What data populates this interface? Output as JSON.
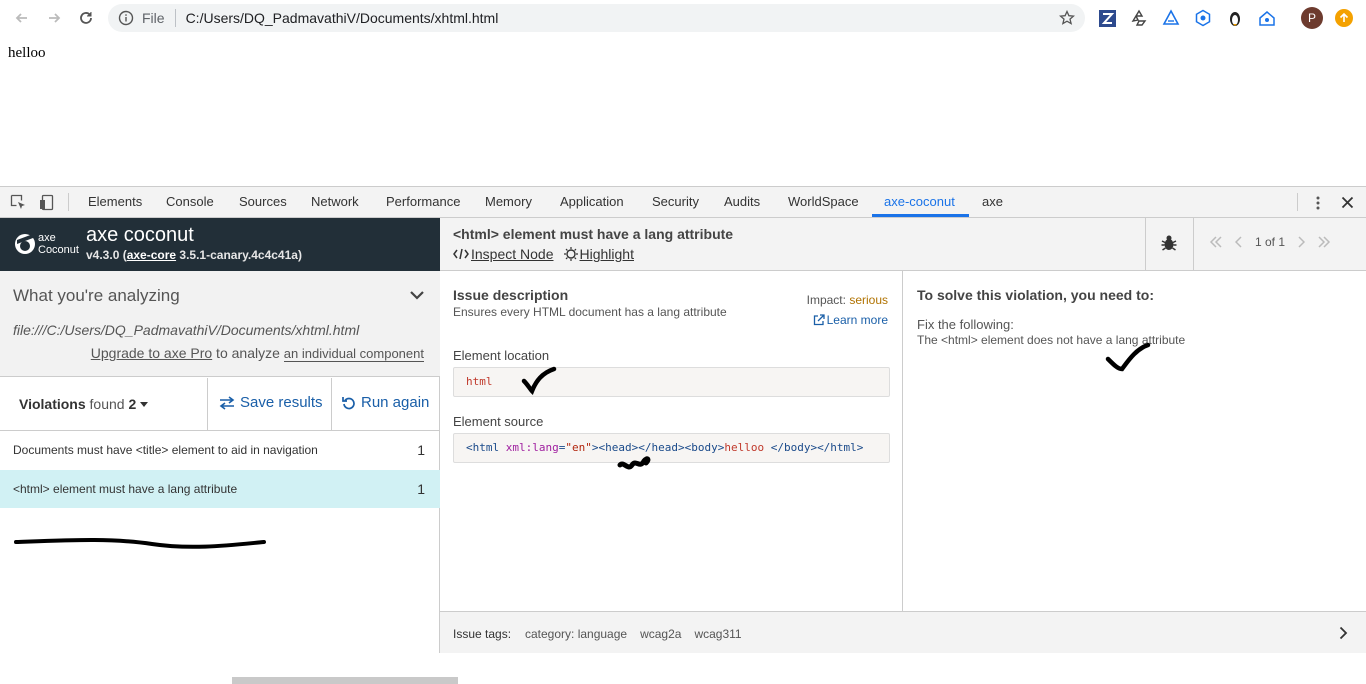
{
  "browser": {
    "scheme": "File",
    "url": "C:/Users/DQ_PadmavathiV/Documents/xhtml.html",
    "avatar_letter": "P"
  },
  "page": {
    "body_text": "helloo"
  },
  "devtools": {
    "tabs": [
      "Elements",
      "Console",
      "Sources",
      "Network",
      "Performance",
      "Memory",
      "Application",
      "Security",
      "Audits",
      "WorldSpace",
      "axe-coconut",
      "axe"
    ],
    "active_tab": "axe-coconut"
  },
  "axe": {
    "brand_small": "axe",
    "brand_coconut": "Coconut",
    "title": "axe coconut",
    "version": "v4.3.0 (",
    "core_link": "axe-core",
    "core_version": " 3.5.1-canary.4c4c41a)",
    "analyzing_title": "What you're analyzing",
    "analyzing_path": "file:///C:/Users/DQ_PadmavathiV/Documents/xhtml.html",
    "upgrade_link": "Upgrade to axe Pro",
    "upgrade_mid": " to analyze ",
    "upgrade_component": "an individual component",
    "violations_label": "Violations",
    "violations_found": " found ",
    "violations_count": "2",
    "save_results": "Save results",
    "run_again": "Run again",
    "violations": [
      {
        "label": "Documents must have <title> element to aid in navigation",
        "count": "1"
      },
      {
        "label": "<html> element must have a lang attribute",
        "count": "1"
      }
    ]
  },
  "detail": {
    "title": "<html> element must have a lang attribute",
    "inspect_node": " Inspect Node",
    "highlight": " Highlight",
    "pager": "1 of 1",
    "issue_heading": "Issue description",
    "issue_desc": "Ensures every HTML document has a lang attribute",
    "impact_label": "Impact: ",
    "impact_value": "serious",
    "learn_more": "Learn more",
    "location_label": "Element location",
    "location_value": "html",
    "source_label": "Element source",
    "source_parts": {
      "lt_html": "<html",
      "attr": " xml:lang",
      "eq": "=",
      "str": "\"en\"",
      "gt": ">",
      "head_open": "<head>",
      "head_close": "</head>",
      "body_open": "<body>",
      "body_text": "helloo ",
      "body_close": "</body>",
      "html_close": "</html>"
    },
    "solve_heading": "To solve this violation, you need to:",
    "fix_label": "Fix the following:",
    "fix_detail": "The <html> element does not have a lang attribute",
    "tags_label": "Issue tags:",
    "tags": [
      "category: language",
      "wcag2a",
      "wcag311"
    ]
  },
  "colors": {
    "accent": "#1a73e8",
    "brand_bg": "#222f38",
    "selected_row": "#d1f1f4",
    "impact_serious": "#b07200"
  }
}
